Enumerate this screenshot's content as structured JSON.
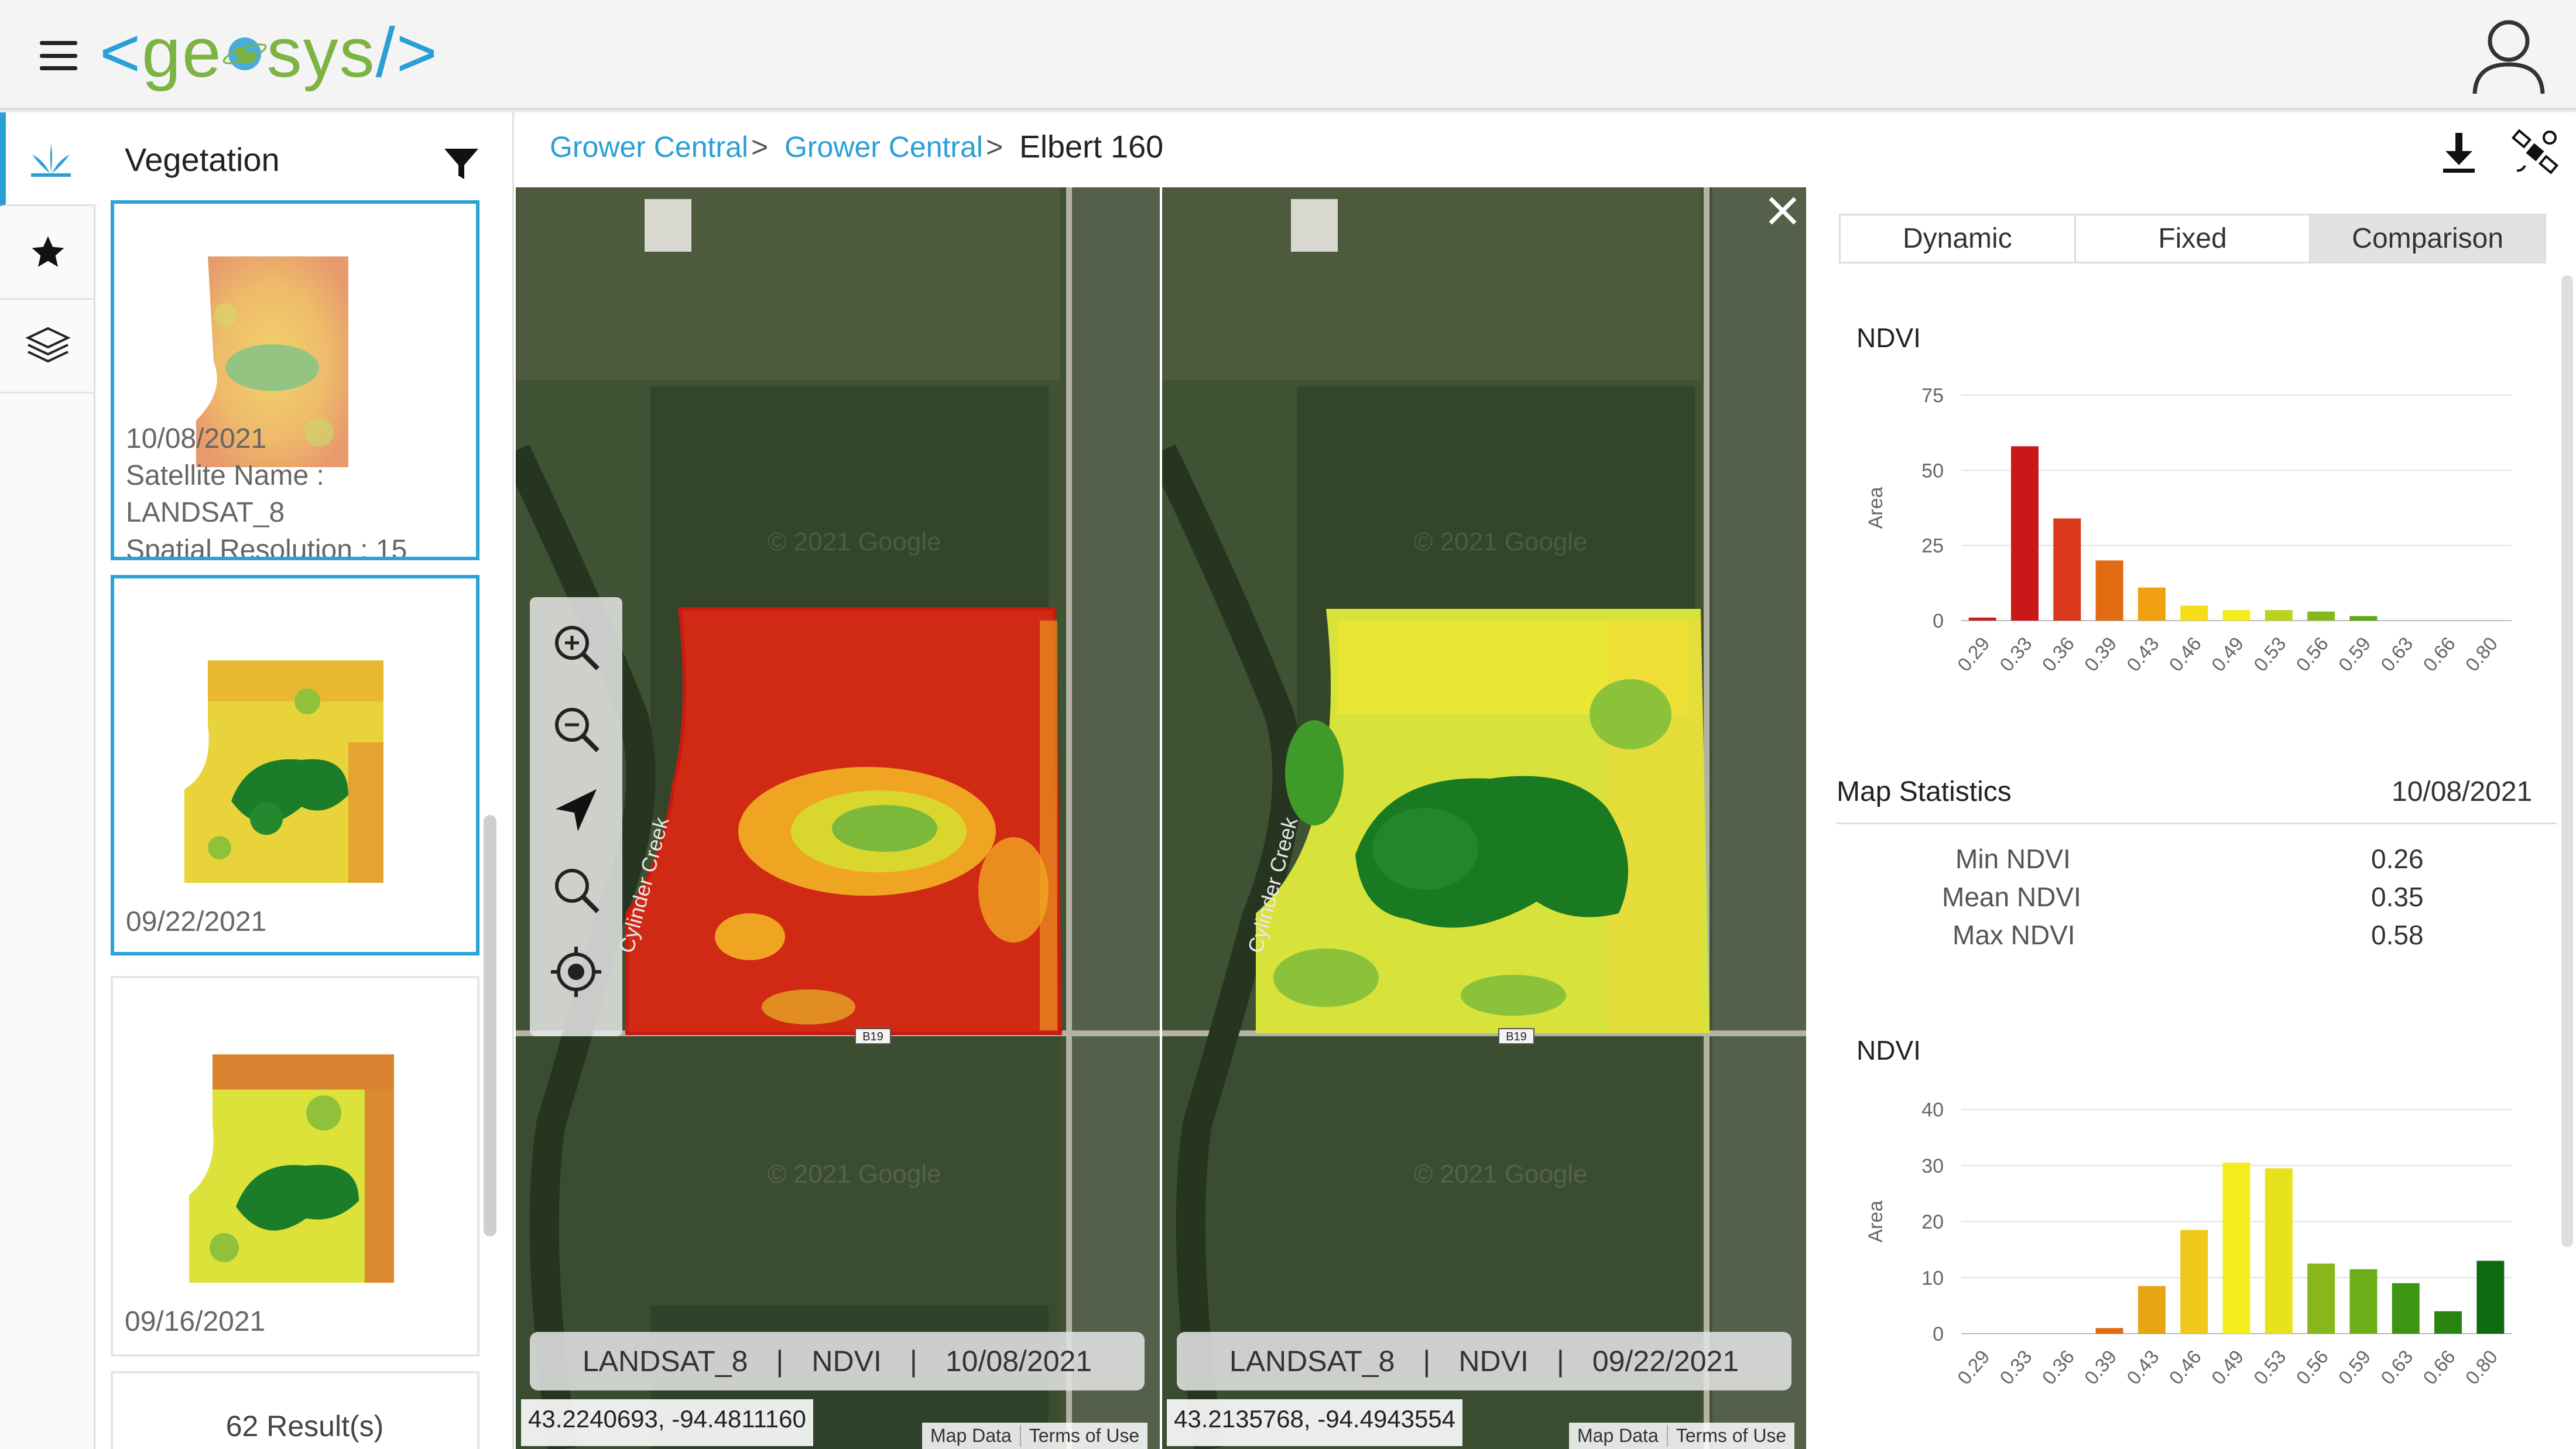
{
  "header": {
    "logo_left": "<",
    "logo_text_pre": "ge",
    "logo_text_post": "sys",
    "logo_right": "/>"
  },
  "icons": {
    "menu": "hamburger-menu-icon",
    "user": "user-profile-icon",
    "vegetation": "vegetation-icon",
    "favorites": "star-icon",
    "layers": "layers-icon",
    "filter": "filter-icon",
    "download": "download-icon",
    "satellite": "satellite-icon",
    "close": "close-icon",
    "zoom_in": "zoom-in-icon",
    "zoom_out": "zoom-out-icon",
    "navigate": "navigation-arrow-icon",
    "search": "search-icon",
    "locate": "locate-target-icon"
  },
  "panel": {
    "title": "Vegetation",
    "cards": [
      {
        "date": "10/08/2021",
        "satellite_label": "Satellite Name :",
        "satellite": "LANDSAT_8",
        "resolution": "Spatial Resolution : 15"
      },
      {
        "date": "09/22/2021"
      },
      {
        "date": "09/16/2021"
      }
    ],
    "results": "62 Result(s)"
  },
  "breadcrumb": {
    "items": [
      "Grower Central",
      "Grower Central"
    ],
    "sep": ">",
    "current": "Elbert 160"
  },
  "maps": [
    {
      "satellite": "LANDSAT_8",
      "index": "NDVI",
      "date": "10/08/2021",
      "divider": "|",
      "coords": "43.2240693, -94.4811160",
      "creek": "Cylinder Creek",
      "road": "B19",
      "watermark": "© 2021 Google",
      "map_data": "Map Data",
      "terms": "Terms of Use"
    },
    {
      "satellite": "LANDSAT_8",
      "index": "NDVI",
      "date": "09/22/2021",
      "divider": "|",
      "coords": "43.2135768, -94.4943554",
      "creek": "Cylinder Creek",
      "road": "B19",
      "watermark": "© 2021 Google",
      "map_data": "Map Data",
      "terms": "Terms of Use"
    }
  ],
  "tabs": [
    "Dynamic",
    "Fixed",
    "Comparison"
  ],
  "active_tab": "Comparison",
  "stats": {
    "title": "Map Statistics",
    "date": "10/08/2021",
    "rows": [
      {
        "label": "Min NDVI",
        "value": "0.26"
      },
      {
        "label": "Mean NDVI",
        "value": "0.35"
      },
      {
        "label": "Max NDVI",
        "value": "0.58"
      }
    ]
  },
  "colors": {
    "accent": "#2a9fd6",
    "logo_green": "#7cb342"
  },
  "chart_data": [
    {
      "type": "bar",
      "title": "NDVI",
      "ylabel": "Area",
      "xlabel": "",
      "categories": [
        "0.29",
        "0.33",
        "0.36",
        "0.39",
        "0.43",
        "0.46",
        "0.49",
        "0.53",
        "0.56",
        "0.59",
        "0.63",
        "0.66",
        "0.80"
      ],
      "values": [
        1,
        58,
        34,
        20,
        11,
        5,
        3.5,
        3.5,
        3,
        1.5,
        0,
        0,
        0
      ],
      "colors": [
        "#c62020",
        "#c81818",
        "#d9381a",
        "#e06b10",
        "#f0a010",
        "#f7dd18",
        "#f5ec1e",
        "#b9d31d",
        "#86b81c",
        "#5fa81a",
        "#3e9512",
        "#2a8510",
        "#0e6b10"
      ],
      "yticks": [
        0,
        25,
        50,
        75
      ],
      "ylim": [
        0,
        75
      ],
      "grid": true
    },
    {
      "type": "bar",
      "title": "NDVI",
      "ylabel": "Area",
      "xlabel": "",
      "categories": [
        "0.29",
        "0.33",
        "0.36",
        "0.39",
        "0.43",
        "0.46",
        "0.49",
        "0.53",
        "0.56",
        "0.59",
        "0.63",
        "0.66",
        "0.80"
      ],
      "values": [
        0,
        0,
        0,
        1,
        8.5,
        18.5,
        30.5,
        29.5,
        12.5,
        11.5,
        9,
        4,
        13
      ],
      "colors": [
        "#c62020",
        "#c81818",
        "#d9381a",
        "#e06b10",
        "#e7a514",
        "#f0c81a",
        "#f5ec1e",
        "#e7e21b",
        "#86b81c",
        "#6eae18",
        "#3e9512",
        "#2a8510",
        "#0e6b10"
      ],
      "yticks": [
        0,
        10,
        20,
        30,
        40
      ],
      "ylim": [
        0,
        40
      ],
      "grid": true
    }
  ]
}
